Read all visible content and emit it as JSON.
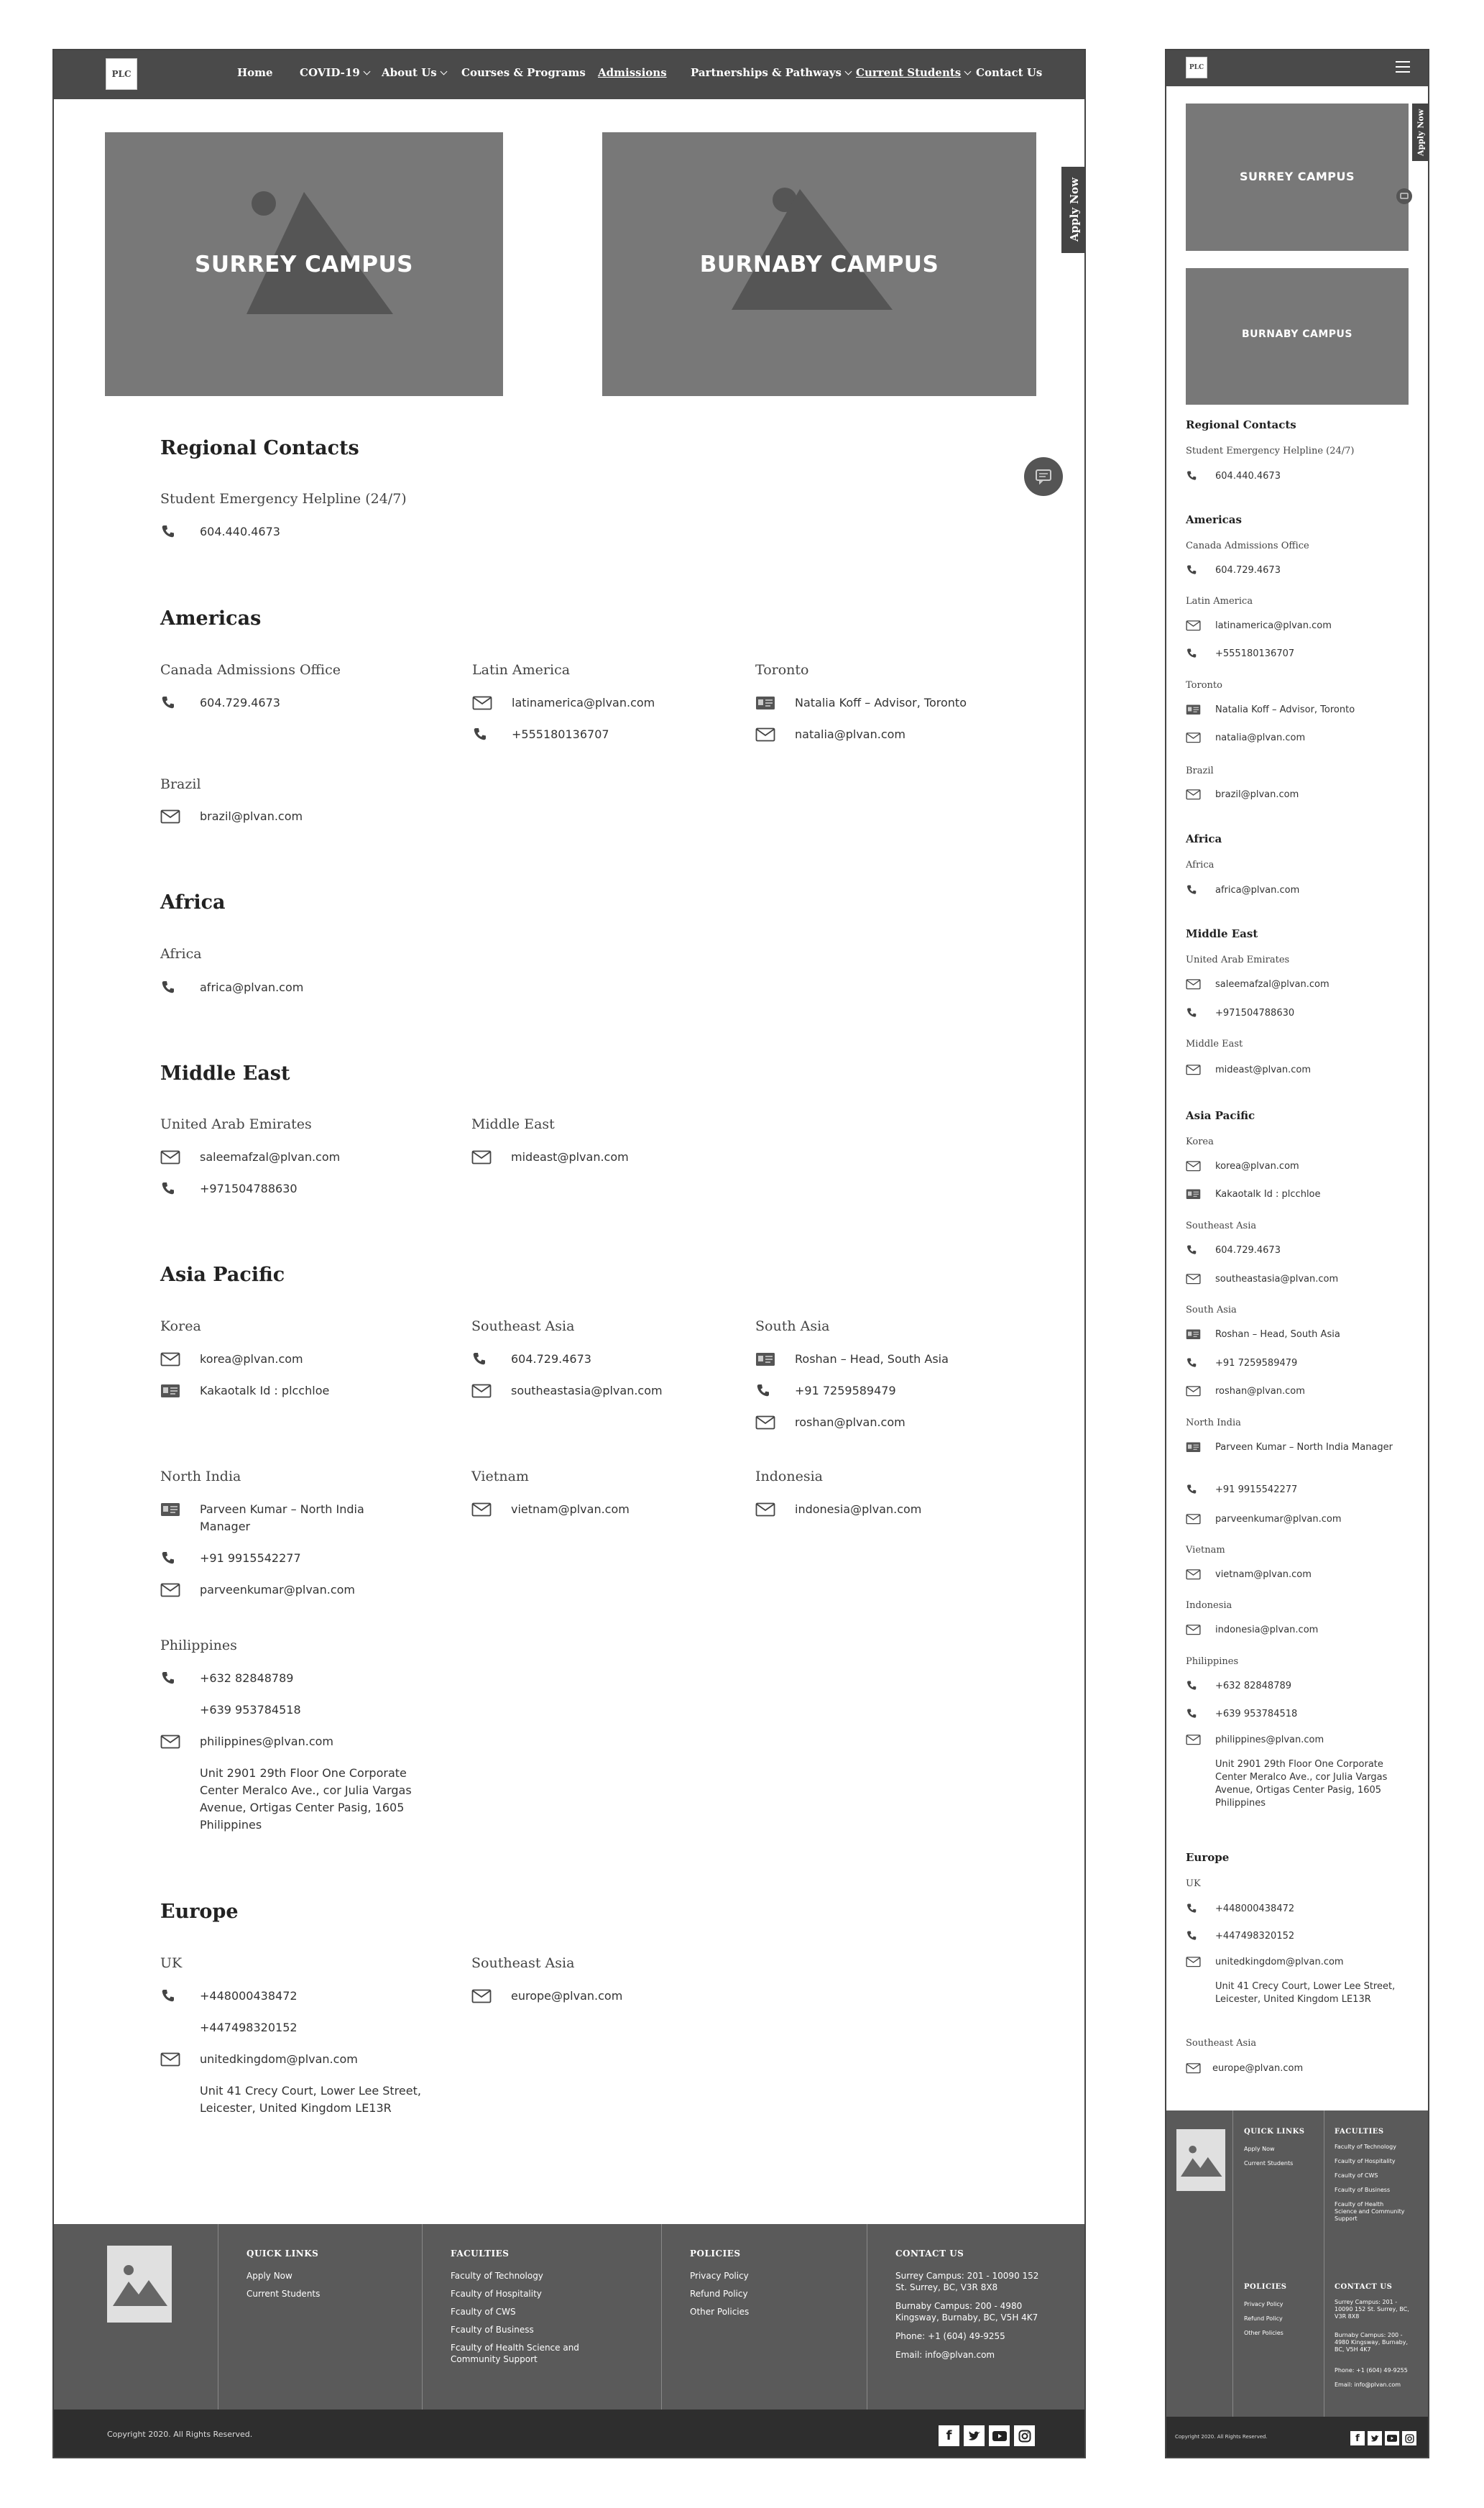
{
  "header": {
    "logo": "PLC",
    "nav": {
      "home": "Home",
      "covid": "COVID-19",
      "about": "About Us",
      "courses": "Courses & Programs",
      "admissions": "Admissions",
      "partnerships": "Partnerships & Pathways",
      "current": "Current Students",
      "contact": "Contact Us"
    },
    "menu_icon": "hamburger-icon"
  },
  "apply_now": "Apply Now",
  "campuses": {
    "surrey": "SURREY CAMPUS",
    "burnaby": "BURNABY CAMPUS"
  },
  "regional": {
    "title": "Regional Contacts",
    "helpline_title": "Student Emergency Helpline (24/7)",
    "helpline_phone": "604.440.4673"
  },
  "americas": {
    "title": "Americas",
    "canada": {
      "title": "Canada Admissions Office",
      "phone": "604.729.4673"
    },
    "latin": {
      "title": "Latin America",
      "email": "latinamerica@plvan.com",
      "phone": "+555180136707"
    },
    "toronto": {
      "title": "Toronto",
      "person": "Natalia Koff – Advisor, Toronto",
      "email": "natalia@plvan.com"
    },
    "brazil": {
      "title": "Brazil",
      "email": "brazil@plvan.com"
    }
  },
  "africa": {
    "title": "Africa",
    "sub": {
      "title": "Africa",
      "email": "africa@plvan.com"
    }
  },
  "middle_east": {
    "title": "Middle East",
    "uae": {
      "title": "United Arab Emirates",
      "email": "saleemafzal@plvan.com",
      "phone": "+971504788630"
    },
    "me": {
      "title": "Middle East",
      "email": "mideast@plvan.com"
    }
  },
  "asia": {
    "title": "Asia Pacific",
    "korea": {
      "title": "Korea",
      "email": "korea@plvan.com",
      "kakao": "Kakaotalk Id : plcchloe"
    },
    "sea": {
      "title": "Southeast Asia",
      "phone": "604.729.4673",
      "email": "southeastasia@plvan.com"
    },
    "south": {
      "title": "South Asia",
      "person": "Roshan – Head, South Asia",
      "phone": "+91 7259589479",
      "email": "roshan@plvan.com"
    },
    "north_india": {
      "title": "North India",
      "person": "Parveen Kumar – North India Manager",
      "phone": "+91 9915542277",
      "email": "parveenkumar@plvan.com"
    },
    "vietnam": {
      "title": "Vietnam",
      "email": "vietnam@plvan.com"
    },
    "indonesia": {
      "title": "Indonesia",
      "email": "indonesia@plvan.com"
    },
    "philippines": {
      "title": "Philippines",
      "phone1": "+632 82848789",
      "phone2": "+639 953784518",
      "email": "philippines@plvan.com",
      "address": "Unit 2901 29th Floor One Corporate Center Meralco Ave., cor Julia Vargas Avenue, Ortigas Center Pasig, 1605 Philippines"
    }
  },
  "europe": {
    "title": "Europe",
    "uk": {
      "title": "UK",
      "phone1": "+448000438472",
      "phone2": "+447498320152",
      "email": "unitedkingdom@plvan.com",
      "address": "Unit 41 Crecy Court, Lower Lee Street, Leicester, United Kingdom LE13R"
    },
    "sea": {
      "title": "Southeast Asia",
      "email": "europe@plvan.com"
    }
  },
  "footer": {
    "quick_links": {
      "title": "QUICK LINKS",
      "items": [
        "Apply Now",
        "Current Students"
      ]
    },
    "faculties": {
      "title": "FACULTIES",
      "items": [
        "Faculty of Technology",
        "Fcaulty of Hospitality",
        "Fcaulty of CWS",
        "Fcaulty of Business",
        "Fcaulty of Health Science and Community Support"
      ]
    },
    "policies": {
      "title": "POLICIES",
      "items": [
        "Privacy Policy",
        "Refund Policy",
        "Other Policies"
      ]
    },
    "contact": {
      "title": "CONTACT US",
      "surrey": "Surrey Campus: 201 - 10090 152 St. Surrey, BC, V3R 8X8",
      "burnaby": "Burnaby Campus: 200 - 4980 Kingsway, Burnaby, BC, V5H 4K7",
      "phone": "Phone: +1 (604) 49-9255",
      "email": "Email: info@plvan.com"
    },
    "copyright": "Copyright 2020. All Rights Reserved.",
    "social": [
      "facebook-icon",
      "twitter-icon",
      "youtube-icon",
      "instagram-icon"
    ]
  }
}
